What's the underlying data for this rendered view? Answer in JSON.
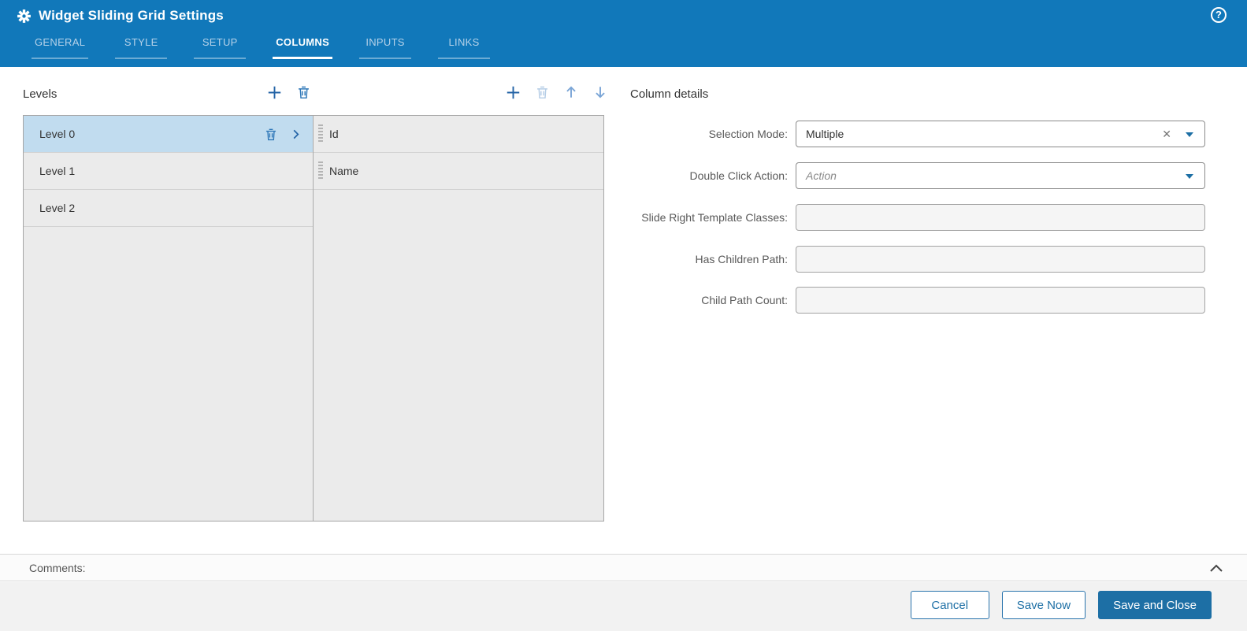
{
  "window": {
    "title": "Widget Sliding Grid Settings"
  },
  "header": {
    "tabs": [
      {
        "label": "GENERAL"
      },
      {
        "label": "STYLE"
      },
      {
        "label": "SETUP"
      },
      {
        "label": "COLUMNS"
      },
      {
        "label": "INPUTS"
      },
      {
        "label": "LINKS"
      }
    ],
    "active_tab": "COLUMNS",
    "icons": {
      "help": "question-mark-circle",
      "app": "gear"
    }
  },
  "levels": {
    "heading": "Levels",
    "toolbar": [
      "add",
      "delete"
    ],
    "items": [
      {
        "label": "Level 0",
        "selected": true
      },
      {
        "label": "Level 1",
        "selected": false
      },
      {
        "label": "Level 2",
        "selected": false
      }
    ]
  },
  "columns": {
    "toolbar": [
      "add",
      "delete",
      "move-up",
      "move-down"
    ],
    "items": [
      {
        "label": "Id"
      },
      {
        "label": "Name"
      }
    ]
  },
  "details": {
    "heading": "Column details",
    "fields": [
      {
        "label": "Selection Mode:",
        "value": "Multiple",
        "type": "dropdown",
        "clearable": true
      },
      {
        "label": "Double Click Action:",
        "placeholder": "Action",
        "type": "dropdown"
      },
      {
        "label": "Slide Right Template Classes:",
        "value": "",
        "type": "text"
      },
      {
        "label": "Has Children Path:",
        "value": "",
        "type": "text"
      },
      {
        "label": "Child Path Count:",
        "value": "",
        "type": "text"
      }
    ]
  },
  "comments": {
    "label": "Comments:"
  },
  "footer": {
    "buttons": [
      {
        "label": "Cancel"
      },
      {
        "label": "Save Now"
      },
      {
        "label": "Save and Close",
        "primary": true
      }
    ]
  },
  "colors": {
    "header_bg": "#1178ba",
    "accent": "#1d6fa5",
    "selected_row": "#c1dcef",
    "row_bg": "#ebebeb",
    "footer_bg": "#f2f2f2"
  }
}
